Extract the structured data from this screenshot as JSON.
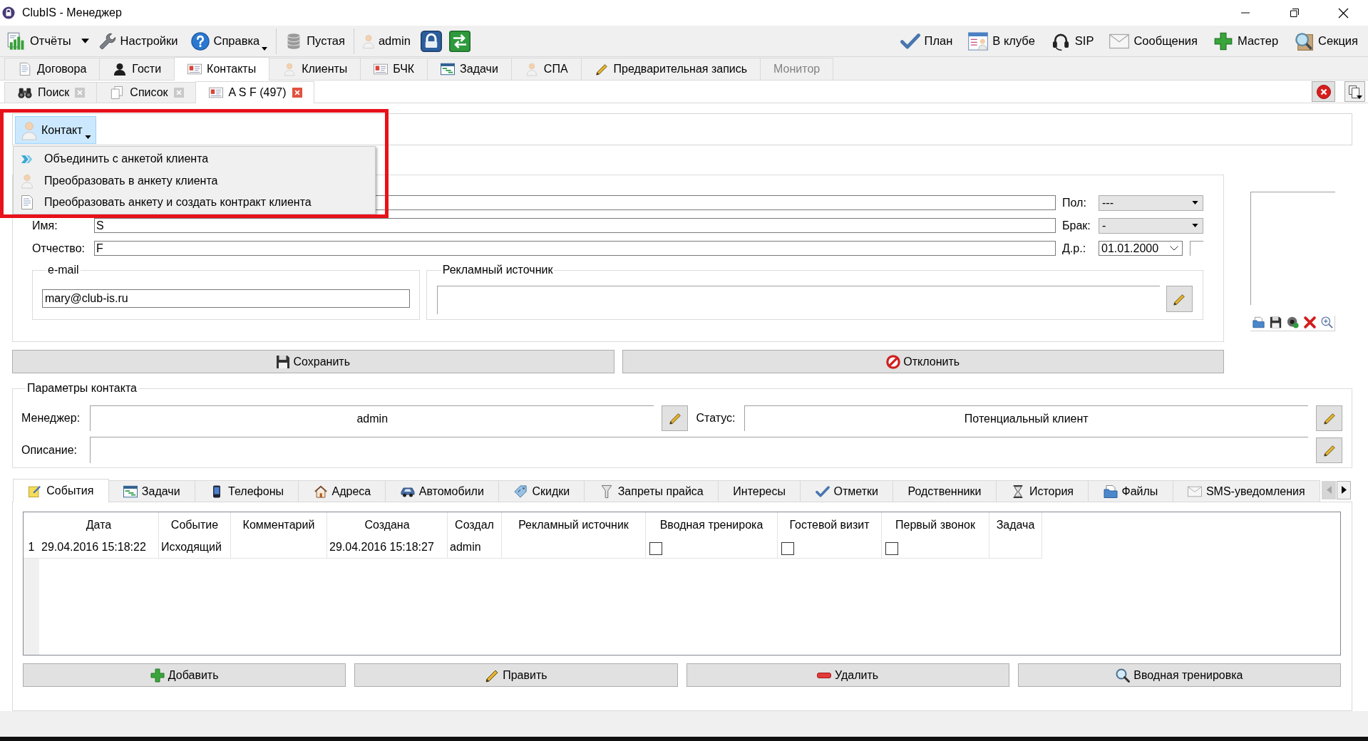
{
  "window": {
    "title": "ClubIS - Менеджер"
  },
  "toolbar": {
    "groups": [
      [
        {
          "kind": "split",
          "label": "Отчёты"
        },
        {
          "kind": "button",
          "label": "Настройки"
        },
        {
          "kind": "menu",
          "label": "Справка"
        }
      ],
      [
        {
          "kind": "button",
          "label": "Пустая"
        }
      ],
      [
        {
          "kind": "user",
          "label": "admin"
        },
        {
          "kind": "icon"
        },
        {
          "kind": "icon"
        }
      ]
    ],
    "right": [
      {
        "label": "План"
      },
      {
        "label": "В клубе"
      },
      {
        "label": "SIP"
      },
      {
        "label": "Сообщения"
      },
      {
        "label": "Мастер"
      },
      {
        "label": "Секция"
      }
    ]
  },
  "module_tabs": [
    {
      "label": "Договора",
      "selected": false,
      "disabled": false
    },
    {
      "label": "Гости",
      "selected": false,
      "disabled": false
    },
    {
      "label": "Контакты",
      "selected": true,
      "disabled": false
    },
    {
      "label": "Клиенты",
      "selected": false,
      "disabled": false
    },
    {
      "label": "БЧК",
      "selected": false,
      "disabled": false
    },
    {
      "label": "Задачи",
      "selected": false,
      "disabled": false
    },
    {
      "label": "СПА",
      "selected": false,
      "disabled": false
    },
    {
      "label": "Предварительная запись",
      "selected": false,
      "disabled": false
    },
    {
      "label": "Монитор",
      "selected": false,
      "disabled": true
    }
  ],
  "document_tabs": [
    {
      "label": "Поиск",
      "selected": false
    },
    {
      "label": "Список",
      "selected": false
    },
    {
      "label": "A S F (497)",
      "selected": true
    }
  ],
  "contact_menu": {
    "label": "Контакт",
    "expanded": true,
    "items": [
      "Объединить с анкетой клиента",
      "Преобразовать в анкету клиента",
      "Преобразовать анкету и создать контракт клиента"
    ]
  },
  "name_rows": [
    {
      "side": {
        "kind": "select",
        "label": "Пол:",
        "value": "---"
      }
    },
    {
      "label": "Имя:",
      "value": "S",
      "side": {
        "kind": "select",
        "label": "Брак:",
        "value": "-"
      }
    },
    {
      "label": "Отчество:",
      "value": "F",
      "side": {
        "kind": "date",
        "label": "Д.р.:",
        "value": "01.01.2000"
      }
    }
  ],
  "email": {
    "title": "e-mail",
    "value": "mary@club-is.ru"
  },
  "ad_source": {
    "title": "Рекламный источник"
  },
  "form_buttons": [
    "Сохранить",
    "Отклонить"
  ],
  "contact_params": {
    "title": "Параметры контакта",
    "rows": [
      [
        {
          "label": "Менеджер:",
          "value": "admin"
        },
        {
          "label": "Статус:",
          "value": "Потенциальный клиент"
        }
      ],
      [
        {
          "label": "Описание:"
        }
      ]
    ]
  },
  "detail_tabs": [
    {
      "label": "События",
      "selected": true
    },
    {
      "label": "Задачи",
      "selected": false
    },
    {
      "label": "Телефоны",
      "selected": false
    },
    {
      "label": "Адреса",
      "selected": false
    },
    {
      "label": "Автомобили",
      "selected": false
    },
    {
      "label": "Скидки",
      "selected": false
    },
    {
      "label": "Запреты прайса",
      "selected": false
    },
    {
      "label": "Интересы",
      "selected": false
    },
    {
      "label": "Отметки",
      "selected": false
    },
    {
      "label": "Родственники",
      "selected": false
    },
    {
      "label": "История",
      "selected": false
    },
    {
      "label": "Файлы",
      "selected": false
    },
    {
      "label": "SMS-уведомления",
      "selected": false
    }
  ],
  "tab_scroll": [
    {
      "disabled": true
    },
    {
      "disabled": false
    }
  ],
  "table": {
    "columns": [
      "Дата",
      "Событие",
      "Комментарий",
      "Создана",
      "Создал",
      "Рекламный источник",
      "Вводная тренирока",
      "Гостевой визит",
      "Первый звонок",
      "Задача"
    ],
    "rows": [
      {
        "number": "1",
        "cells": [
          {
            "kind": "text",
            "text": "29.04.2016 15:18:22"
          },
          {
            "kind": "text",
            "text": "Исходящий"
          },
          {
            "kind": "text"
          },
          {
            "kind": "text",
            "text": "29.04.2016 15:18:27"
          },
          {
            "kind": "text",
            "text": "admin"
          },
          {
            "kind": "text"
          },
          {
            "kind": "check",
            "checked": false
          },
          {
            "kind": "check",
            "checked": false
          },
          {
            "kind": "check",
            "checked": false
          },
          {
            "kind": "text"
          }
        ]
      }
    ]
  },
  "table_buttons": [
    "Добавить",
    "Править",
    "Удалить",
    "Вводная тренировка"
  ]
}
